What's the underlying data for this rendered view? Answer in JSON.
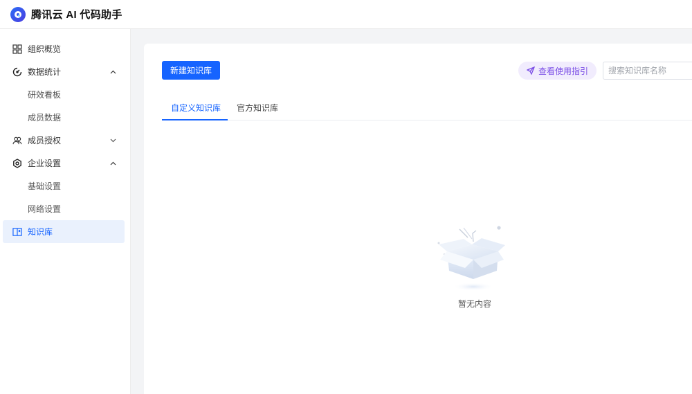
{
  "app": {
    "title": "腾讯云 AI 代码助手"
  },
  "sidebar": {
    "items": [
      {
        "label": "组织概览",
        "icon": "grid-icon"
      },
      {
        "label": "数据统计",
        "icon": "gauge-icon",
        "expanded": true
      },
      {
        "label": "研效看板"
      },
      {
        "label": "成员数据"
      },
      {
        "label": "成员授权",
        "icon": "users-icon",
        "expanded": false
      },
      {
        "label": "企业设置",
        "icon": "hexagon-settings-icon",
        "expanded": true
      },
      {
        "label": "基础设置"
      },
      {
        "label": "网络设置"
      },
      {
        "label": "知识库",
        "icon": "book-icon",
        "active": true
      }
    ]
  },
  "toolbar": {
    "new_button": "新建知识库",
    "guide_label": "查看使用指引",
    "search_placeholder": "搜索知识库名称"
  },
  "tabs": [
    {
      "label": "自定义知识库",
      "active": true
    },
    {
      "label": "官方知识库",
      "active": false
    }
  ],
  "empty_state": {
    "text": "暂无内容"
  },
  "colors": {
    "primary": "#1664ff",
    "guide": "#7b4ee6",
    "guide_bg": "#f1ecfd",
    "active_bg": "#eaf1fd"
  }
}
